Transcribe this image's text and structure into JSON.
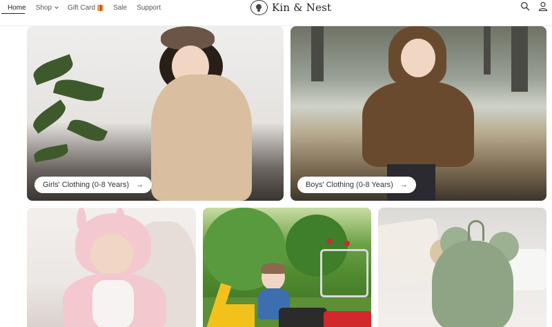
{
  "header": {
    "nav": {
      "home": "Home",
      "shop": "Shop",
      "gift_card": "Gift Card",
      "sale": "Sale",
      "support": "Support"
    },
    "brand": "Kin & Nest",
    "icons": [
      "search-icon",
      "account-icon"
    ]
  },
  "collections": {
    "girls": {
      "label": "Girls' Clothing (0-8 Years)",
      "arrow": "→"
    },
    "boys": {
      "label": "Boys' Clothing (0-8 Years)",
      "arrow": "→"
    }
  },
  "colors": {
    "nav_text": "#555555",
    "active_underline": "#222222",
    "pill_bg": "#ffffff"
  }
}
